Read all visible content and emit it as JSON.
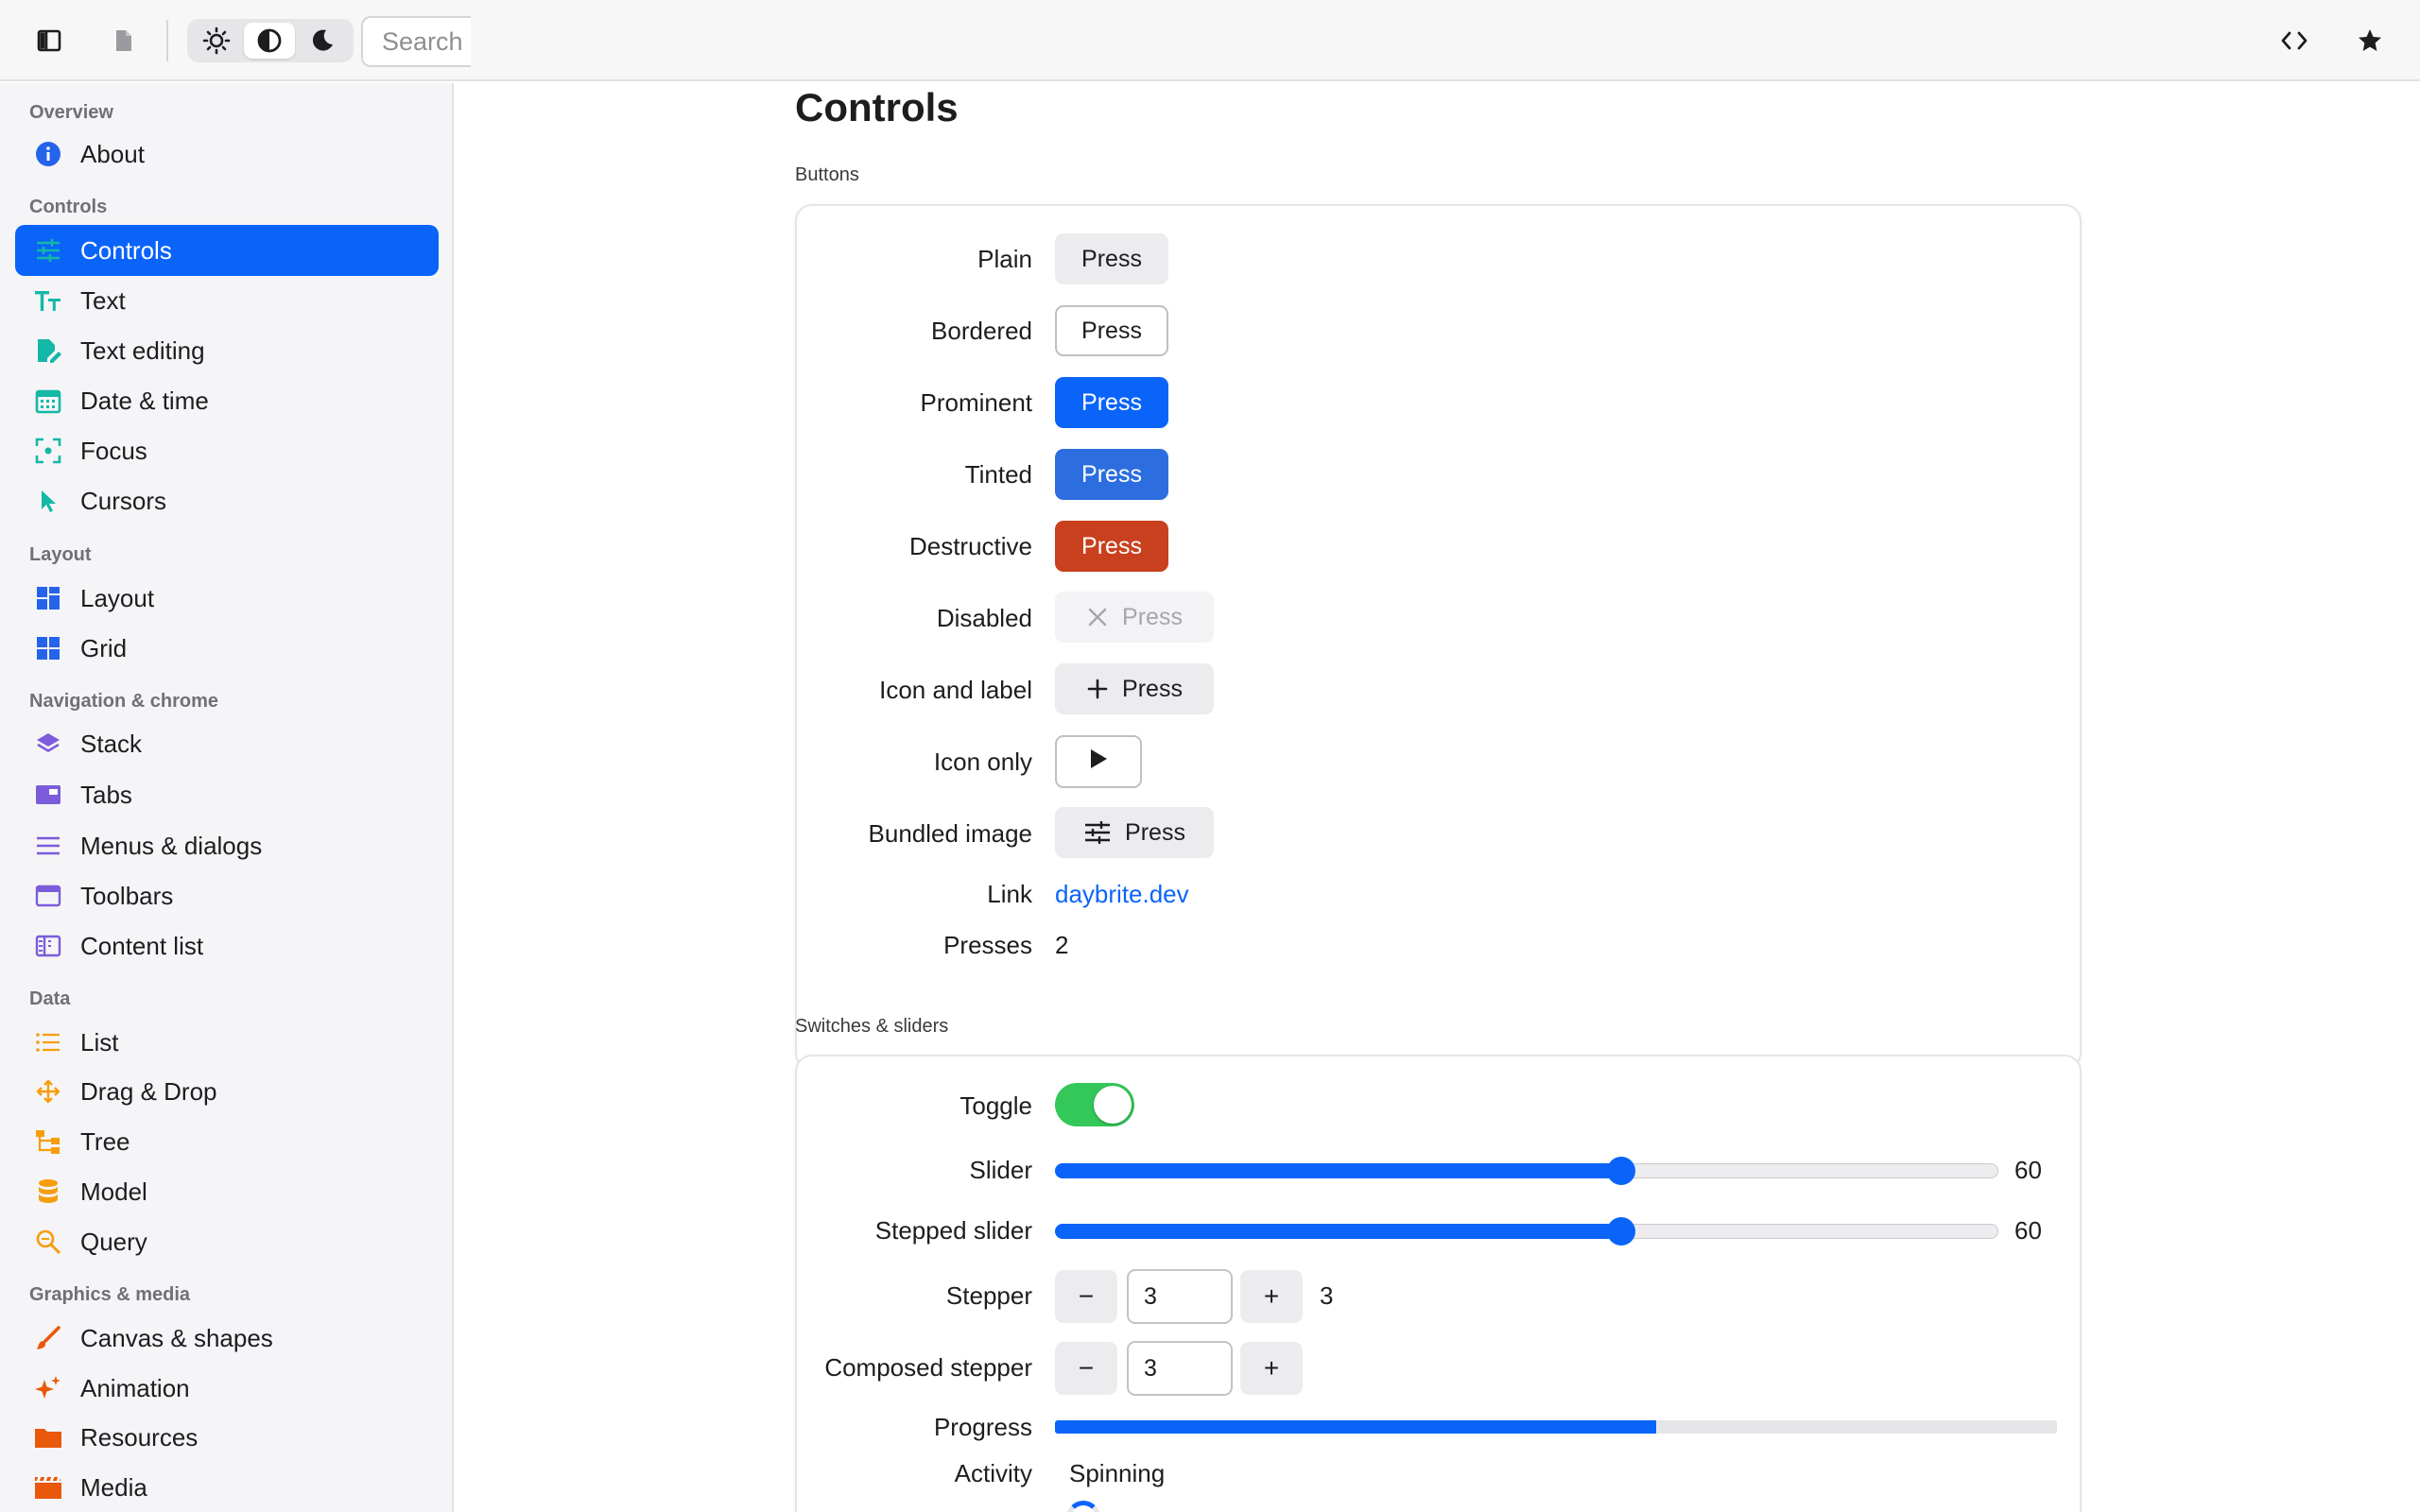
{
  "toolbar": {
    "search_placeholder": "Search",
    "theme_options": [
      "light",
      "auto",
      "dark"
    ],
    "active_theme": "auto"
  },
  "sidebar": {
    "sections": [
      {
        "label": "Overview",
        "items": [
          {
            "label": "About",
            "icon": "info-icon",
            "color": "#2563eb"
          }
        ]
      },
      {
        "label": "Controls",
        "items": [
          {
            "label": "Controls",
            "icon": "sliders-icon",
            "color": "#14b8a6",
            "active": true
          },
          {
            "label": "Text",
            "icon": "text-icon",
            "color": "#14b8a6"
          },
          {
            "label": "Text editing",
            "icon": "edit-document-icon",
            "color": "#14b8a6"
          },
          {
            "label": "Date & time",
            "icon": "calendar-icon",
            "color": "#14b8a6"
          },
          {
            "label": "Focus",
            "icon": "focus-icon",
            "color": "#14b8a6"
          },
          {
            "label": "Cursors",
            "icon": "cursor-icon",
            "color": "#14b8a6"
          }
        ]
      },
      {
        "label": "Layout",
        "items": [
          {
            "label": "Layout",
            "icon": "layout-icon",
            "color": "#2563eb"
          },
          {
            "label": "Grid",
            "icon": "grid-icon",
            "color": "#2563eb"
          }
        ]
      },
      {
        "label": "Navigation & chrome",
        "items": [
          {
            "label": "Stack",
            "icon": "stack-icon",
            "color": "#7c5cdb"
          },
          {
            "label": "Tabs",
            "icon": "tabs-icon",
            "color": "#7c5cdb"
          },
          {
            "label": "Menus & dialogs",
            "icon": "menu-icon",
            "color": "#7c5cdb"
          },
          {
            "label": "Toolbars",
            "icon": "toolbar-icon",
            "color": "#7c5cdb"
          },
          {
            "label": "Content list",
            "icon": "content-list-icon",
            "color": "#7c5cdb"
          }
        ]
      },
      {
        "label": "Data",
        "items": [
          {
            "label": "List",
            "icon": "list-icon",
            "color": "#f59e0b"
          },
          {
            "label": "Drag & Drop",
            "icon": "drag-icon",
            "color": "#f59e0b"
          },
          {
            "label": "Tree",
            "icon": "tree-icon",
            "color": "#f59e0b"
          },
          {
            "label": "Model",
            "icon": "database-icon",
            "color": "#f59e0b"
          },
          {
            "label": "Query",
            "icon": "search-icon",
            "color": "#f59e0b"
          }
        ]
      },
      {
        "label": "Graphics & media",
        "items": [
          {
            "label": "Canvas & shapes",
            "icon": "brush-icon",
            "color": "#ea580c"
          },
          {
            "label": "Animation",
            "icon": "sparkles-icon",
            "color": "#ea580c"
          },
          {
            "label": "Resources",
            "icon": "folder-icon",
            "color": "#ea580c"
          },
          {
            "label": "Media",
            "icon": "film-icon",
            "color": "#ea580c"
          }
        ]
      }
    ]
  },
  "main": {
    "title": "Controls",
    "buttons_group": {
      "title": "Buttons",
      "rows": {
        "plain": {
          "label": "Plain",
          "button": "Press"
        },
        "bordered": {
          "label": "Bordered",
          "button": "Press"
        },
        "prominent": {
          "label": "Prominent",
          "button": "Press"
        },
        "tinted": {
          "label": "Tinted",
          "button": "Press"
        },
        "destructive": {
          "label": "Destructive",
          "button": "Press"
        },
        "disabled": {
          "label": "Disabled",
          "button": "Press"
        },
        "icon_and_label": {
          "label": "Icon and label",
          "button": "Press"
        },
        "icon_only": {
          "label": "Icon only"
        },
        "bundled_image": {
          "label": "Bundled image",
          "button": "Press"
        },
        "link": {
          "label": "Link",
          "text": "daybrite.dev"
        },
        "presses": {
          "label": "Presses",
          "value": "2"
        }
      }
    },
    "switches_group": {
      "title": "Switches & sliders",
      "toggle": {
        "label": "Toggle",
        "on": true
      },
      "slider": {
        "label": "Slider",
        "value": 60,
        "display": "60",
        "min": 0,
        "max": 100
      },
      "stepped_slider": {
        "label": "Stepped slider",
        "value": 60,
        "display": "60",
        "min": 0,
        "max": 100
      },
      "stepper": {
        "label": "Stepper",
        "minus": "−",
        "plus": "+",
        "field": "3",
        "value": "3"
      },
      "composed_stepper": {
        "label": "Composed stepper",
        "minus": "−",
        "plus": "+",
        "field": "3"
      },
      "progress": {
        "label": "Progress",
        "value": 0.6
      },
      "activity": {
        "label": "Activity",
        "text": "Spinning"
      }
    }
  },
  "colors": {
    "accent": "#0a64fa",
    "destructive": "#c9401e",
    "toggle_on": "#34c759"
  }
}
